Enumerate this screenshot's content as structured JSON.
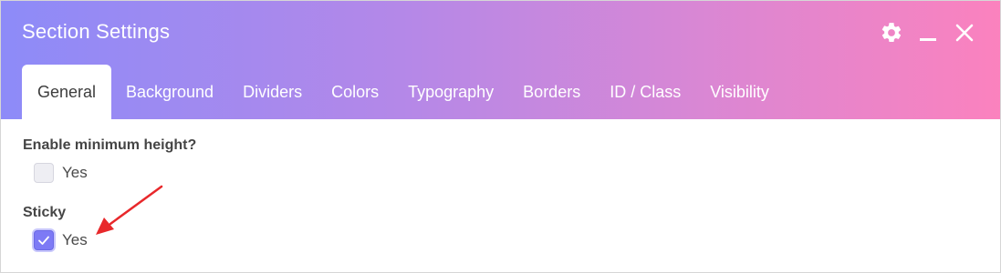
{
  "dialog": {
    "title": "Section Settings",
    "icons": [
      "gear-icon",
      "minimize-icon",
      "close-icon"
    ]
  },
  "tabs": [
    {
      "label": "General",
      "active": true
    },
    {
      "label": "Background",
      "active": false
    },
    {
      "label": "Dividers",
      "active": false
    },
    {
      "label": "Colors",
      "active": false
    },
    {
      "label": "Typography",
      "active": false
    },
    {
      "label": "Borders",
      "active": false
    },
    {
      "label": "ID / Class",
      "active": false
    },
    {
      "label": "Visibility",
      "active": false
    }
  ],
  "fields": {
    "min_height": {
      "label": "Enable minimum height?",
      "option": "Yes",
      "checked": false
    },
    "sticky": {
      "label": "Sticky",
      "option": "Yes",
      "checked": true
    }
  },
  "colors": {
    "header_gradient_start": "#8d8bf8",
    "header_gradient_end": "#fb82be",
    "checkbox_accent": "#7d7af5",
    "annotation_arrow": "#e8282b"
  }
}
